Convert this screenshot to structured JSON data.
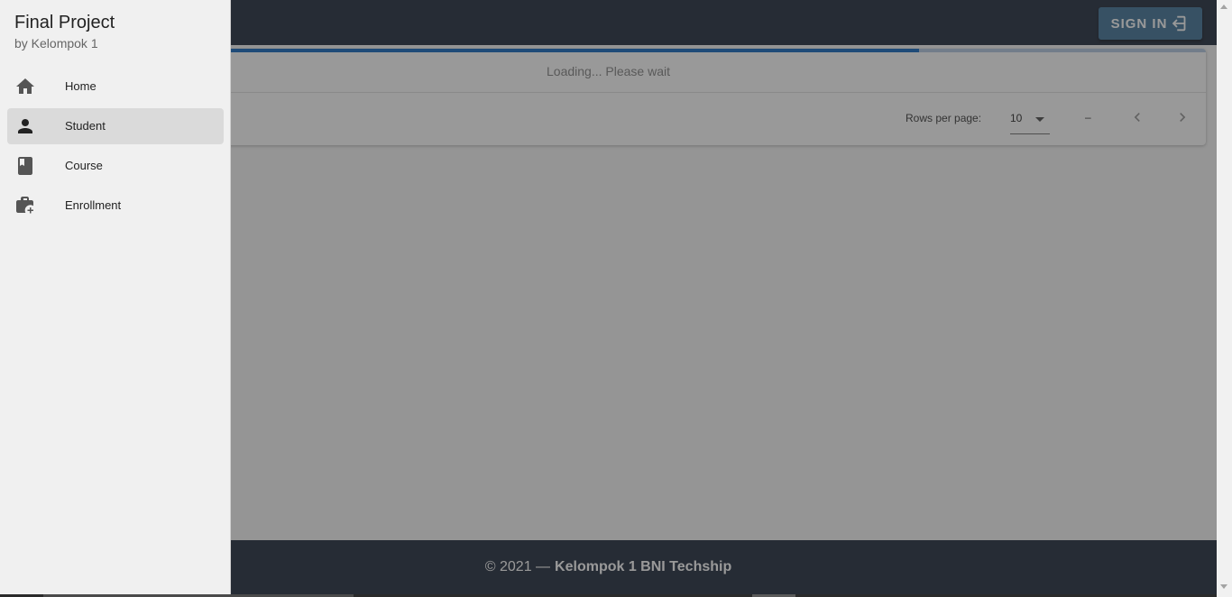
{
  "app_bar": {
    "signin_label": "SIGN IN",
    "signin_icon": "login-icon",
    "background": "#2c3646",
    "button_color": "#4a7b9d"
  },
  "drawer": {
    "title": "Final Project",
    "subtitle": "by Kelompok 1",
    "items": [
      {
        "label": "Home",
        "icon": "home-icon",
        "active": false
      },
      {
        "label": "Student",
        "icon": "person-icon",
        "active": true
      },
      {
        "label": "Course",
        "icon": "book-icon",
        "active": false
      },
      {
        "label": "Enrollment",
        "icon": "briefcase-plus-icon",
        "active": false
      }
    ]
  },
  "table": {
    "loading_progress": 0.76,
    "loading_text": "Loading... Please wait",
    "rows_per_page_label": "Rows per page:",
    "rows_per_page_value": "10",
    "page_range": "–"
  },
  "footer": {
    "prefix": "© 2021 —",
    "strong": "Kelompok 1 BNI Techship"
  },
  "colors": {
    "progress": "#1f6fc2",
    "progress_track": "#b8cbe3",
    "active_item": "#dadada"
  }
}
